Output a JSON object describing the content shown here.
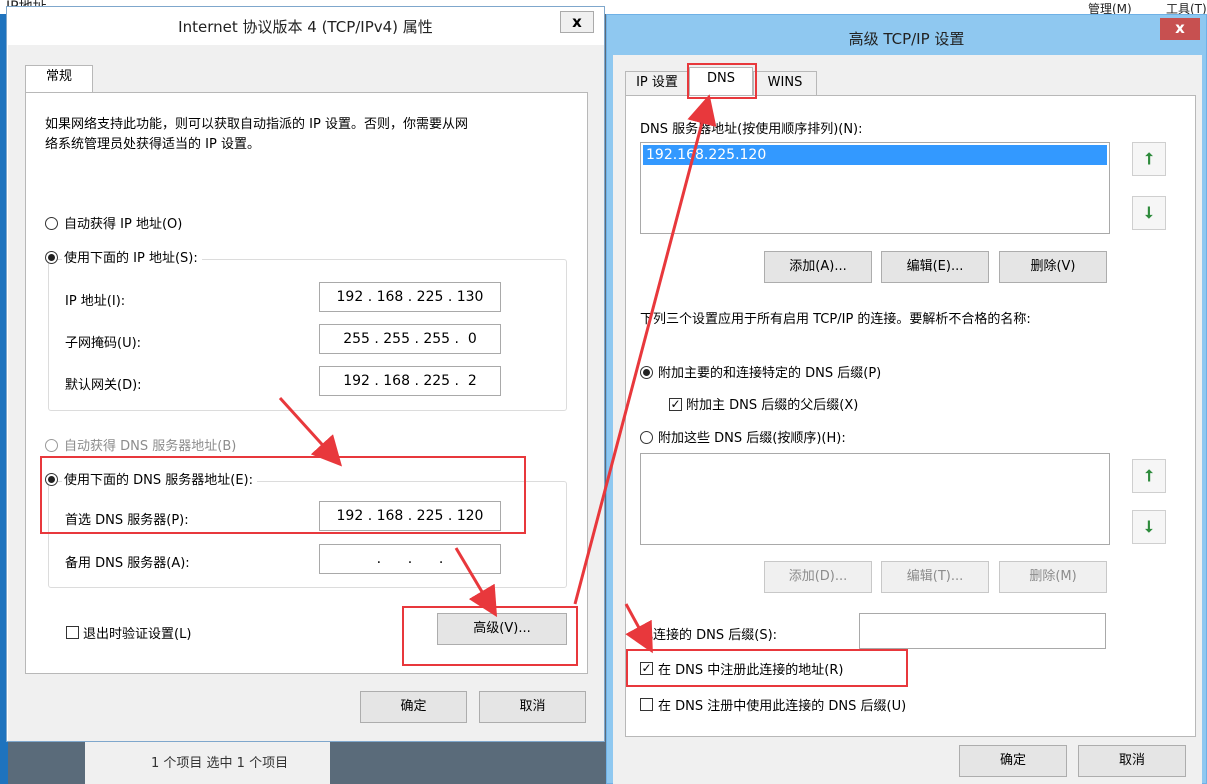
{
  "background": {
    "top_text": "IP地址 ...   ...",
    "status_items": "1 个项目    选中 1 个项目",
    "right_menu": [
      "管理(M)",
      "工具(T)"
    ]
  },
  "ipv4_dialog": {
    "title": "Internet 协议版本 4 (TCP/IPv4) 属性",
    "close": "x",
    "tab": "常规",
    "description": [
      "如果网络支持此功能，则可以获取自动指派的 IP 设置。否则，你需要从网",
      "络系统管理员处获得适当的 IP 设置。"
    ],
    "auto_ip": "自动获得 IP 地址(O)",
    "manual_ip": "使用下面的 IP 地址(S):",
    "ip_label": "IP 地址(I):",
    "ip_value": "192 . 168 . 225 . 130",
    "mask_label": "子网掩码(U):",
    "mask_value": "255 . 255 . 255 .  0",
    "gateway_label": "默认网关(D):",
    "gateway_value": "192 . 168 . 225 .  2",
    "auto_dns": "自动获得 DNS 服务器地址(B)",
    "manual_dns": "使用下面的 DNS 服务器地址(E):",
    "preferred_dns_label": "首选 DNS 服务器(P):",
    "preferred_dns_value": "192 . 168 . 225 . 120",
    "alt_dns_label": "备用 DNS 服务器(A):",
    "alt_dns_value": "  .      .      .  ",
    "validate": "退出时验证设置(L)",
    "advanced": "高级(V)...",
    "ok": "确定",
    "cancel": "取消"
  },
  "adv_dialog": {
    "title": "高级 TCP/IP 设置",
    "close": "x",
    "tabs": [
      "IP 设置",
      "DNS",
      "WINS"
    ],
    "dns_list_label": "DNS 服务器地址(按使用顺序排列)(N):",
    "dns_list": [
      "192.168.225.120"
    ],
    "add1": "添加(A)...",
    "edit1": "编辑(E)...",
    "remove1": "删除(V)",
    "settings_desc": "下列三个设置应用于所有启用 TCP/IP 的连接。要解析不合格的名称:",
    "opt_primary": "附加主要的和连接特定的 DNS 后缀(P)",
    "opt_parent": "附加主 DNS 后缀的父后缀(X)",
    "opt_these": "附加这些 DNS 后缀(按顺序)(H):",
    "add2": "添加(D)...",
    "edit2": "编辑(T)...",
    "remove2": "删除(M)",
    "suffix_label": "此连接的 DNS 后缀(S):",
    "register": "在 DNS 中注册此连接的地址(R)",
    "use_suffix": "在 DNS 注册中使用此连接的 DNS 后缀(U)",
    "ok": "确定",
    "cancel": "取消"
  },
  "colors": {
    "annotation_red": "#e8383c",
    "selection_blue": "#3399ff",
    "close_red": "#c75050",
    "arrow_green": "#2e8b3c"
  }
}
